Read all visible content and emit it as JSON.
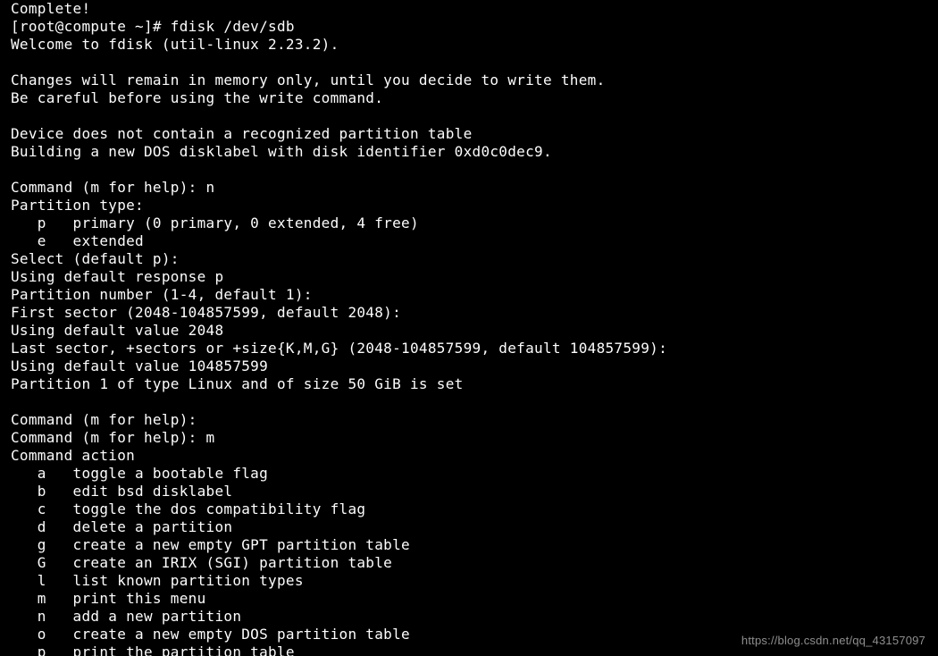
{
  "terminal": {
    "lines": [
      "Complete!",
      "[root@compute ~]# fdisk /dev/sdb",
      "Welcome to fdisk (util-linux 2.23.2).",
      "",
      "Changes will remain in memory only, until you decide to write them.",
      "Be careful before using the write command.",
      "",
      "Device does not contain a recognized partition table",
      "Building a new DOS disklabel with disk identifier 0xd0c0dec9.",
      "",
      "Command (m for help): n",
      "Partition type:",
      "   p   primary (0 primary, 0 extended, 4 free)",
      "   e   extended",
      "Select (default p):",
      "Using default response p",
      "Partition number (1-4, default 1):",
      "First sector (2048-104857599, default 2048):",
      "Using default value 2048",
      "Last sector, +sectors or +size{K,M,G} (2048-104857599, default 104857599):",
      "Using default value 104857599",
      "Partition 1 of type Linux and of size 50 GiB is set",
      "",
      "Command (m for help):",
      "Command (m for help): m",
      "Command action",
      "   a   toggle a bootable flag",
      "   b   edit bsd disklabel",
      "   c   toggle the dos compatibility flag",
      "   d   delete a partition",
      "   g   create a new empty GPT partition table",
      "   G   create an IRIX (SGI) partition table",
      "   l   list known partition types",
      "   m   print this menu",
      "   n   add a new partition",
      "   o   create a new empty DOS partition table",
      "   p   print the partition table"
    ]
  },
  "watermark": "https://blog.csdn.net/qq_43157097"
}
